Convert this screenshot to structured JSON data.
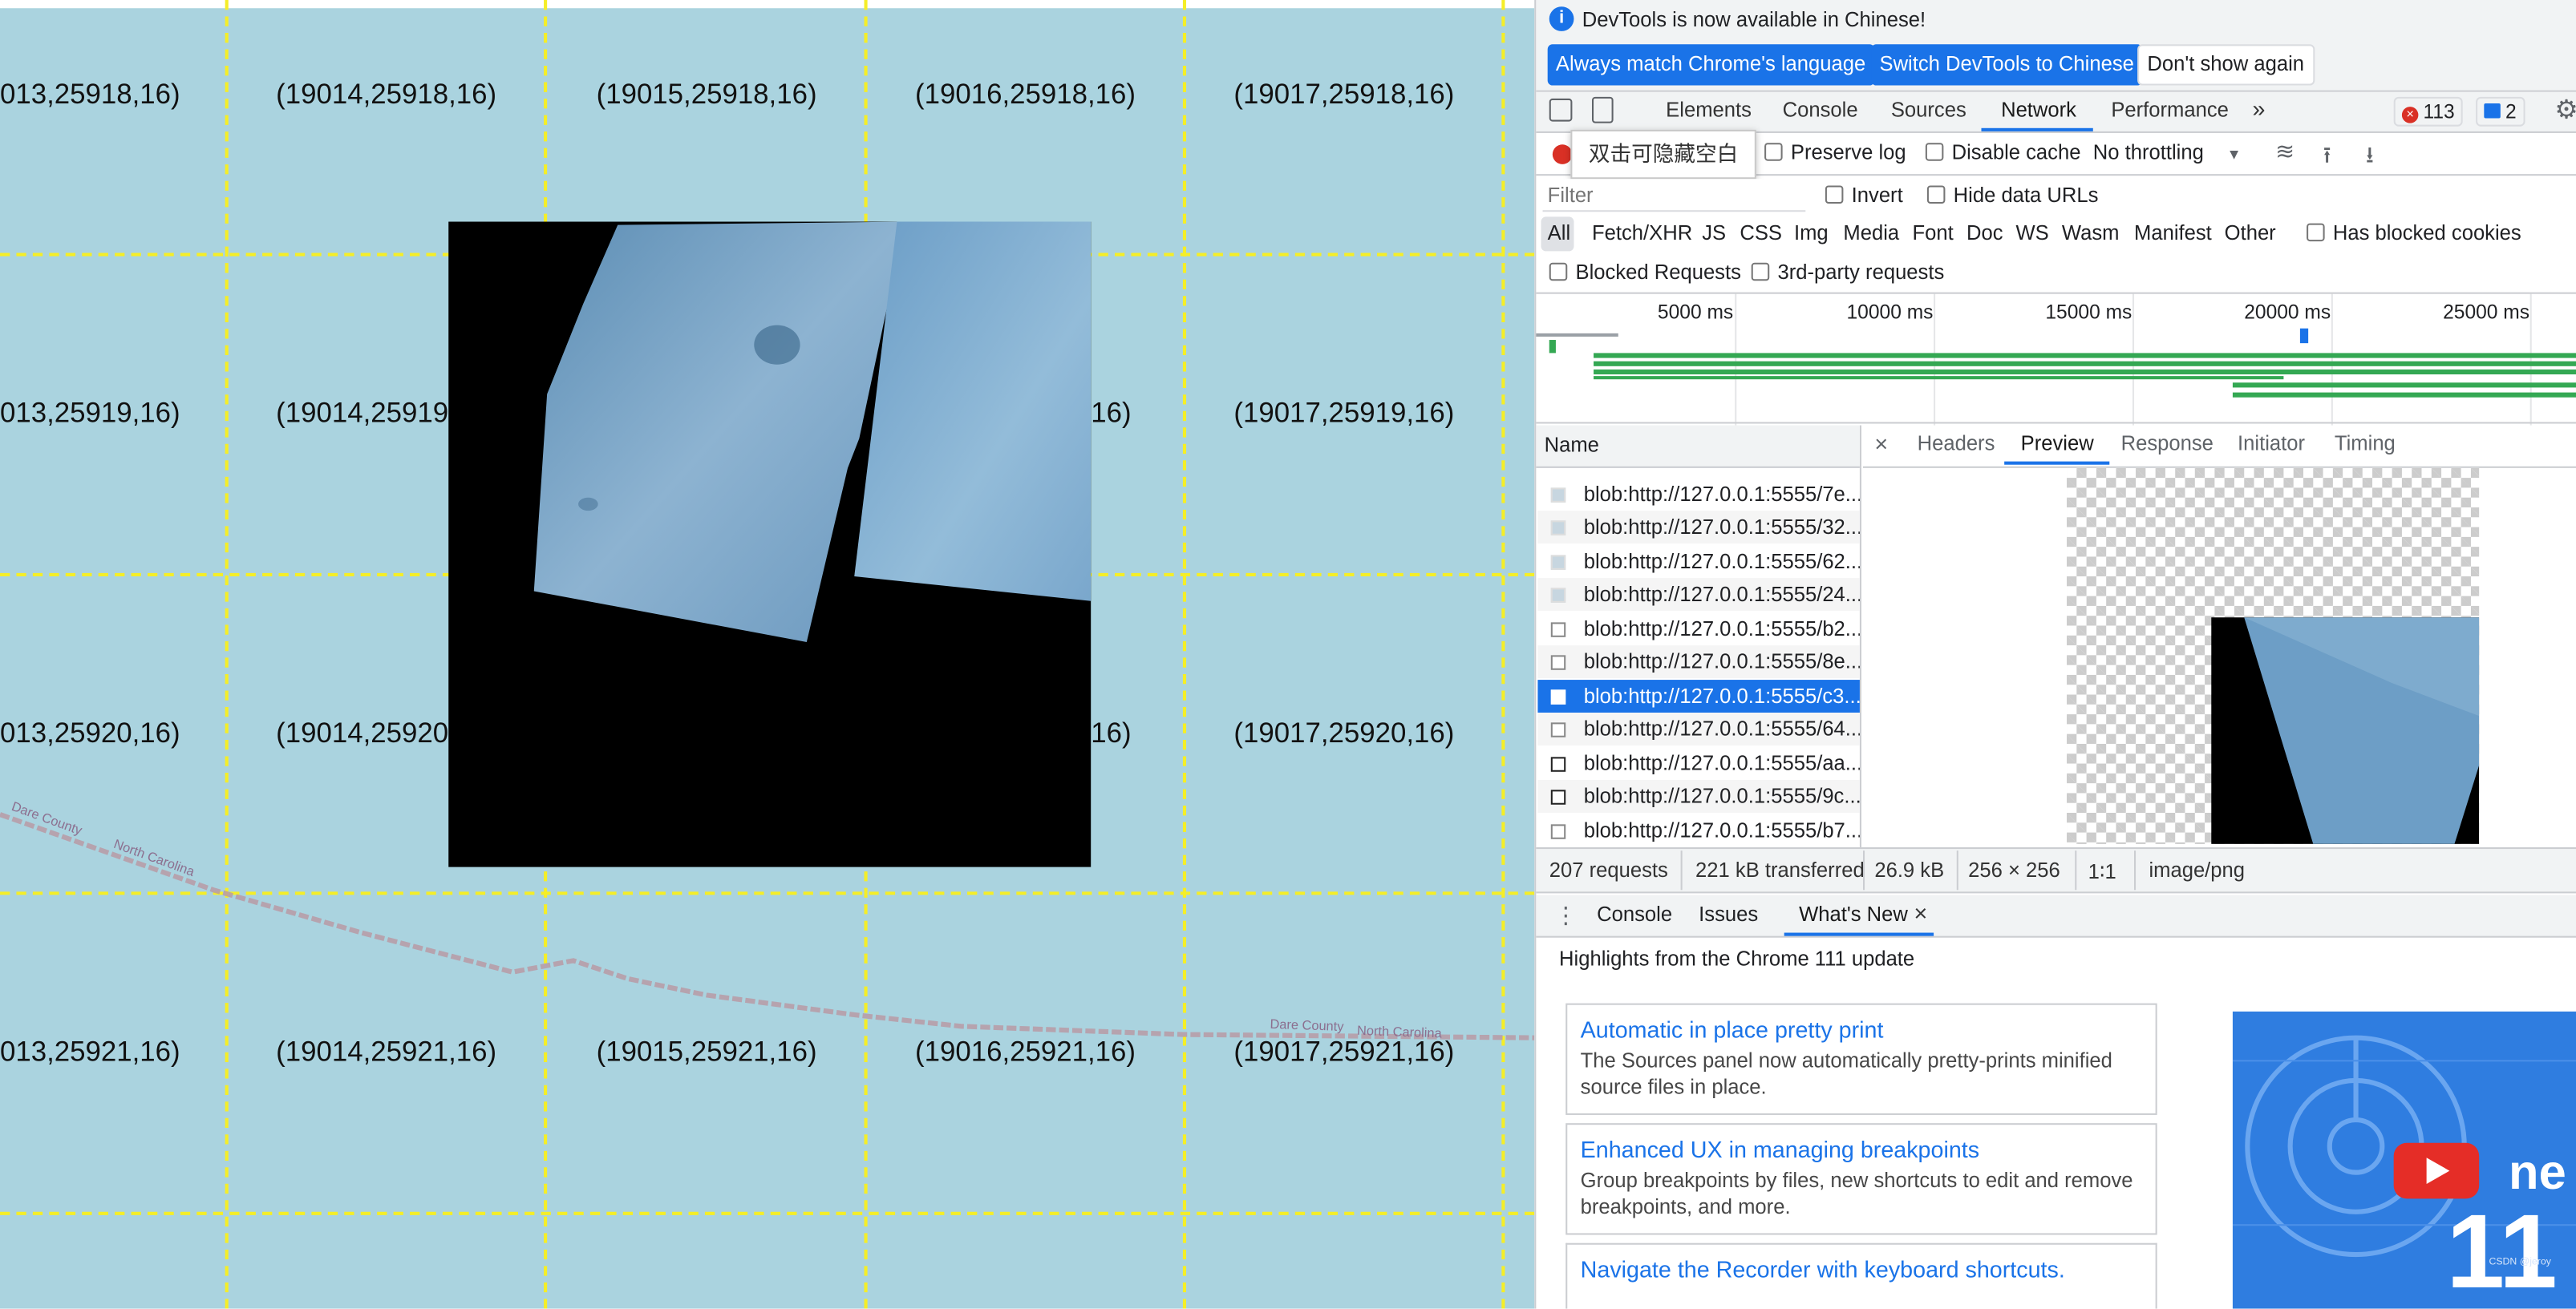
{
  "map": {
    "tiles": [
      [
        "013,25918,16)",
        "(19014,25918,16)",
        "(19015,25918,16)",
        "(19016,25918,16)",
        "(19017,25918,16)"
      ],
      [
        "013,25919,16)",
        "(19014,25919",
        "16)",
        "(19017,25919,16)"
      ],
      [
        "013,25920,16)",
        "(19014,25920",
        "16)",
        "(19017,25920,16)"
      ],
      [
        "013,25921,16)",
        "(19014,25921,16)",
        "(19015,25921,16)",
        "(19016,25921,16)",
        "(19017,25921,16)"
      ]
    ],
    "labels": [
      "Dare County",
      "North Carolina",
      "Dare County",
      "North Carolina"
    ]
  },
  "devtools": {
    "infobar": {
      "text": "DevTools is now available in Chinese!",
      "btn_match": "Always match Chrome's language",
      "btn_switch": "Switch DevTools to Chinese",
      "btn_dismiss": "Don't show again"
    },
    "tabs": [
      "Elements",
      "Console",
      "Sources",
      "Network",
      "Performance"
    ],
    "active_tab": "Network",
    "more_tabs": "»",
    "errors": "113",
    "messages": "2",
    "tooltip": "双击可隐藏空白",
    "toolbar": {
      "preserve_log": "Preserve log",
      "disable_cache": "Disable cache",
      "throttling": "No throttling"
    },
    "filter": {
      "placeholder": "Filter",
      "invert": "Invert",
      "hide_data": "Hide data URLs"
    },
    "types": [
      "All",
      "Fetch/XHR",
      "JS",
      "CSS",
      "Img",
      "Media",
      "Font",
      "Doc",
      "WS",
      "Wasm",
      "Manifest",
      "Other"
    ],
    "has_blocked_cookies": "Has blocked cookies",
    "blocked_requests": "Blocked Requests",
    "third_party": "3rd-party requests",
    "timeline": [
      "5000 ms",
      "10000 ms",
      "15000 ms",
      "20000 ms",
      "25000 ms"
    ],
    "name_header": "Name",
    "requests": [
      "blob:http://127.0.0.1:5555/7e...",
      "blob:http://127.0.0.1:5555/32...",
      "blob:http://127.0.0.1:5555/62...",
      "blob:http://127.0.0.1:5555/24...",
      "blob:http://127.0.0.1:5555/b2...",
      "blob:http://127.0.0.1:5555/8e...",
      "blob:http://127.0.0.1:5555/c3...",
      "blob:http://127.0.0.1:5555/64...",
      "blob:http://127.0.0.1:5555/aa...",
      "blob:http://127.0.0.1:5555/9c...",
      "blob:http://127.0.0.1:5555/b7..."
    ],
    "selected_request": 6,
    "close_x": "×",
    "preview_tabs": [
      "Headers",
      "Preview",
      "Response",
      "Initiator",
      "Timing"
    ],
    "active_preview_tab": "Preview",
    "status": {
      "requests": "207 requests",
      "transferred": "221 kB transferred",
      "size": "26.9 kB",
      "dims": "256 × 256",
      "ratio": "1∶1",
      "mime": "image/png"
    },
    "drawer_tabs": [
      "Console",
      "Issues",
      "What's New"
    ],
    "drawer_close": "×",
    "whatsnew": {
      "headline": "Highlights from the Chrome 111 update",
      "cards": [
        {
          "title": "Automatic in place pretty print",
          "desc": "The Sources panel now automatically pretty-prints minified source files in place."
        },
        {
          "title": "Enhanced UX in managing breakpoints",
          "desc": "Group breakpoints by files, new shortcuts to edit and remove breakpoints, and more."
        },
        {
          "title": "Navigate the Recorder with keyboard shortcuts.",
          "desc": ""
        }
      ],
      "video_text": "ne",
      "video_num": "11",
      "watermark": "CSDN @jeroy"
    }
  }
}
